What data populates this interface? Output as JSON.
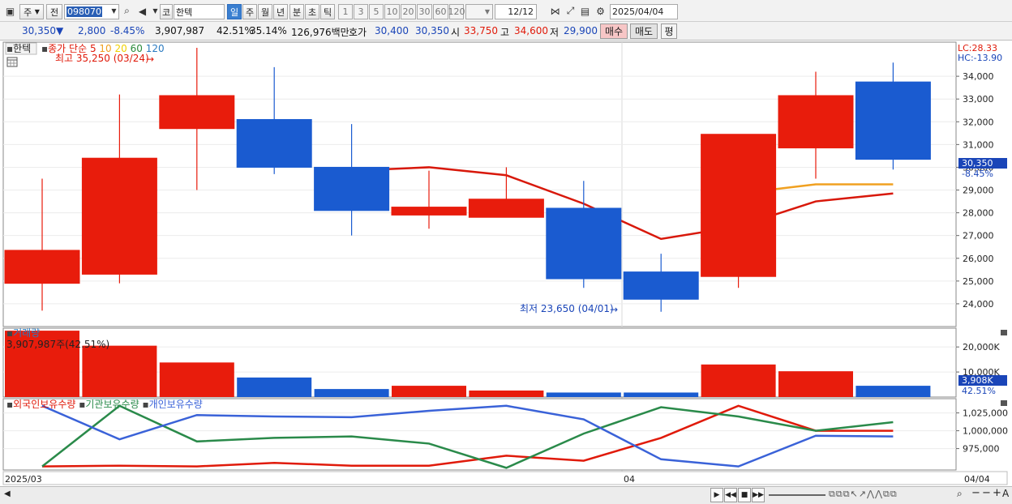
{
  "toolbar": {
    "market": "주",
    "prev": "전",
    "code": "098070",
    "name": "한텍",
    "kosdaq": "코",
    "periods": [
      "일",
      "주",
      "월",
      "년",
      "분",
      "초",
      "틱"
    ],
    "active_period": "일",
    "intervals": [
      "1",
      "3",
      "5",
      "10",
      "20",
      "30",
      "60",
      "120"
    ],
    "count": "12",
    "count_total": "/12",
    "date": "2025/04/04"
  },
  "quote": {
    "price": "30,350",
    "direction": "▼",
    "change": "2,800",
    "change_pct": "-8.45%",
    "volume": "3,907,987",
    "volume_ratio": "42.51%",
    "turnover": "35.14%",
    "amount": "126,976백만",
    "bid_label": "호가",
    "ask_price": "30,400",
    "bid_price": "30,350",
    "open_label": "시",
    "open": "33,750",
    "high_label": "고",
    "high": "34,600",
    "low_label": "저",
    "low": "29,900",
    "buy": "매수",
    "sell": "매도",
    "eval": "평"
  },
  "price_panel": {
    "name_tag": "한텍",
    "legend_label": "종가 단순",
    "ma_periods": [
      "5",
      "10",
      "20",
      "60",
      "120"
    ],
    "ma_colors": [
      "#e01a0a",
      "#f0a020",
      "#f0d000",
      "#2a8a3a",
      "#2a7ac0"
    ],
    "high_marker": "최고 35,250 (03/24)",
    "low_marker": "최저 23,650 (04/01)",
    "lc": "LC:28.33",
    "hc": "HC:-13.90",
    "current_price": "30,350",
    "current_pct": "-8.45%"
  },
  "volume_panel": {
    "title": "거래량",
    "current": "3,907,987주(42.51%)",
    "axis_current": "3,908K",
    "axis_pct": "42.51%"
  },
  "holdings_panel": {
    "legend": [
      "외국인보유수량",
      "기관보유수량",
      "개인보유수량"
    ],
    "colors": [
      "#e01a0a",
      "#2a8a4a",
      "#3a62d8"
    ]
  },
  "x_axis": {
    "start": "2025/03",
    "mid": "04",
    "end": "04/04"
  },
  "chart_data": [
    {
      "type": "candlestick",
      "candles": [
        {
          "open": 24900,
          "close": 26350,
          "high": 29500,
          "low": 23700,
          "color": "up"
        },
        {
          "open": 25300,
          "close": 30400,
          "high": 33200,
          "low": 24900,
          "color": "up"
        },
        {
          "open": 31700,
          "close": 33150,
          "high": 35250,
          "low": 29000,
          "color": "up"
        },
        {
          "open": 32100,
          "close": 30000,
          "high": 34400,
          "low": 29700,
          "color": "down"
        },
        {
          "open": 30000,
          "close": 28100,
          "high": 31900,
          "low": 27000,
          "color": "down"
        },
        {
          "open": 27900,
          "close": 28250,
          "high": 29850,
          "low": 27300,
          "color": "up"
        },
        {
          "open": 27800,
          "close": 28600,
          "high": 30000,
          "low": 27800,
          "color": "up"
        },
        {
          "open": 28200,
          "close": 25100,
          "high": 29400,
          "low": 24700,
          "color": "down"
        },
        {
          "open": 25400,
          "close": 24200,
          "high": 26200,
          "low": 23650,
          "color": "down"
        },
        {
          "open": 25200,
          "close": 31450,
          "high": 31450,
          "low": 24700,
          "color": "up"
        },
        {
          "open": 30850,
          "close": 33150,
          "high": 34200,
          "low": 29500,
          "color": "up"
        },
        {
          "open": 33750,
          "close": 30350,
          "high": 34600,
          "low": 29900,
          "color": "down"
        }
      ],
      "ma5": [
        null,
        null,
        null,
        null,
        29850,
        30000,
        29650,
        28400,
        26850,
        27400,
        28500,
        28850
      ],
      "ma10": [
        null,
        null,
        null,
        null,
        null,
        null,
        null,
        null,
        null,
        28850,
        29250,
        29250
      ],
      "ylim": [
        23000,
        35500
      ],
      "yticks": [
        "24,000",
        "25,000",
        "26,000",
        "27,000",
        "28,000",
        "29,000",
        "30,000",
        "31,000",
        "32,000",
        "33,000",
        "34,000"
      ]
    },
    {
      "type": "bar",
      "volumes": [
        26500,
        20500,
        13800,
        7800,
        3200,
        4500,
        2600,
        1800,
        1800,
        13000,
        10300,
        4500
      ],
      "colors": [
        "up",
        "up",
        "up",
        "down",
        "down",
        "up",
        "up",
        "down",
        "down",
        "up",
        "up",
        "down"
      ],
      "ylim": [
        0,
        27500
      ],
      "yticks": [
        "10,000K",
        "20,000K"
      ]
    },
    {
      "type": "line",
      "series": [
        {
          "name": "외국인보유수량",
          "values": [
            950000,
            951000,
            950000,
            955000,
            951000,
            951000,
            965000,
            958000,
            990000,
            1035000,
            1000000,
            1000000
          ]
        },
        {
          "name": "기관보유수량",
          "values": [
            950000,
            1035000,
            985000,
            990000,
            992000,
            982000,
            948000,
            996000,
            1033000,
            1020000,
            1000000,
            1012000
          ]
        },
        {
          "name": "개인보유수량",
          "values": [
            1035000,
            988000,
            1022000,
            1020000,
            1019000,
            1028000,
            1035000,
            1016000,
            960000,
            950000,
            993000,
            992000
          ]
        }
      ],
      "ylim": [
        945000,
        1045000
      ],
      "yticks": [
        "975,000",
        "1,000,000",
        "1,025,000"
      ]
    }
  ]
}
